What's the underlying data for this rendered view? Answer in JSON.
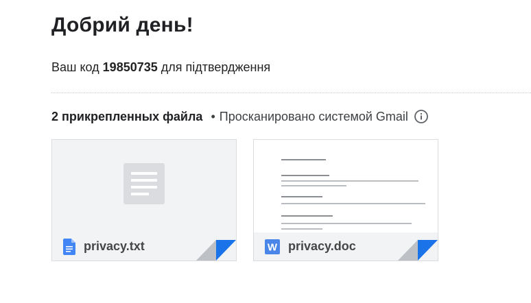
{
  "greeting": "Добрий день!",
  "code_message": {
    "prefix": "Ваш код",
    "code": "19850735",
    "suffix": "для підтвердження"
  },
  "attachments": {
    "count_label": "2 прикрепленных файла",
    "separator": "•",
    "scan_label": "Просканировано системой Gmail",
    "scan_info_icon": "info-icon",
    "files": [
      {
        "name": "privacy.txt",
        "icon": "google-docs-icon",
        "icon_color": "#4285f4"
      },
      {
        "name": "privacy.doc",
        "icon": "word-icon",
        "icon_color": "#4a86e8"
      }
    ]
  },
  "colors": {
    "corner_blue": "#1a73e8",
    "corner_gray": "#bdc1c6"
  }
}
